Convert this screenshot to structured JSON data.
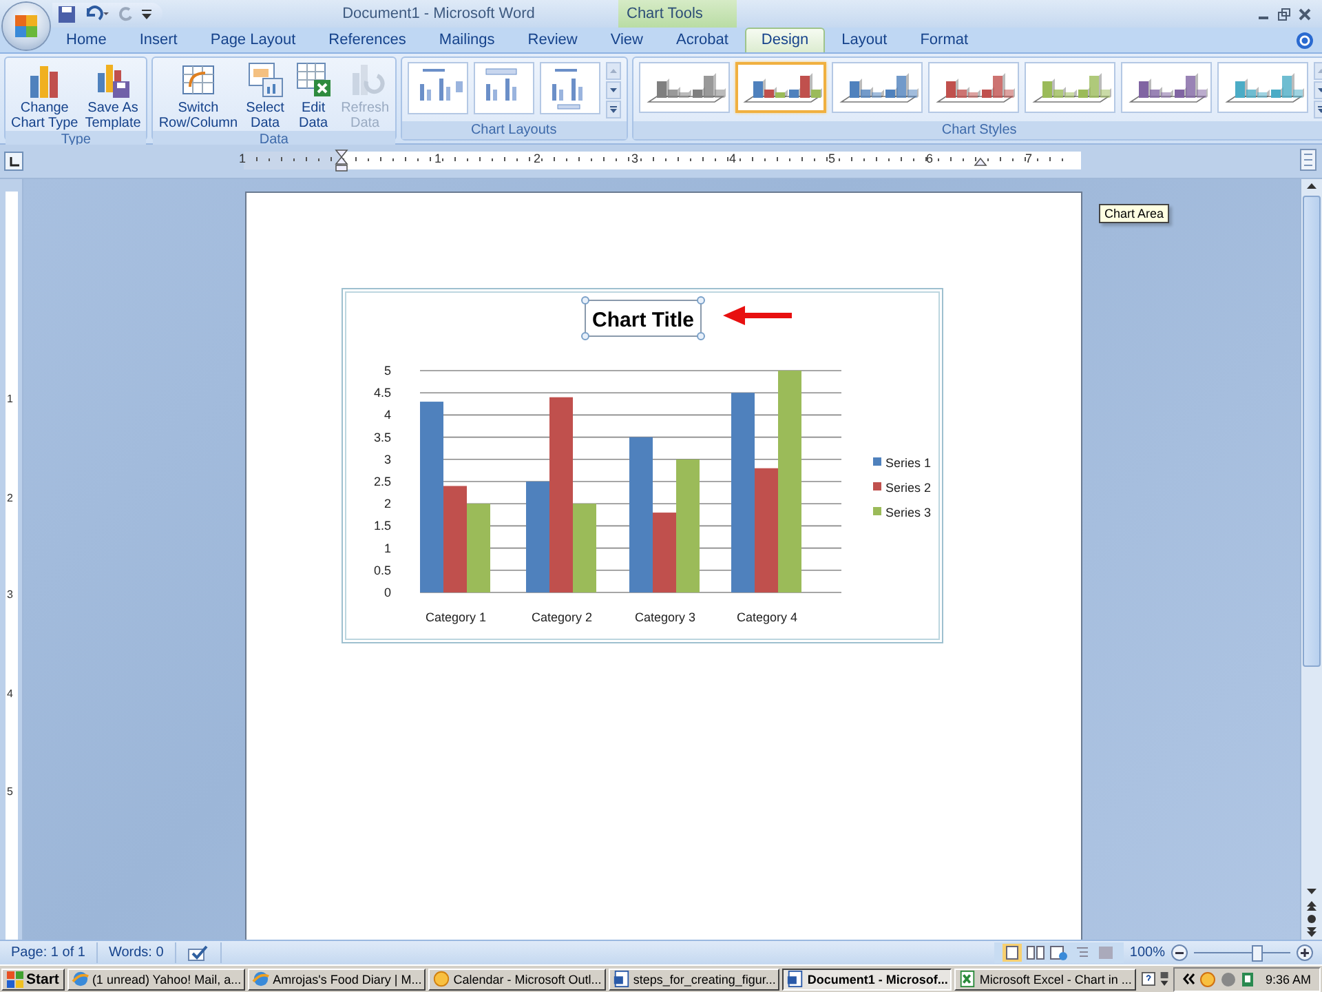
{
  "title_bar": {
    "title": "Document1 - Microsoft Word",
    "contextual_tab": "Chart Tools"
  },
  "tabs": [
    {
      "label": "Home",
      "selected": false
    },
    {
      "label": "Insert",
      "selected": false
    },
    {
      "label": "Page Layout",
      "selected": false
    },
    {
      "label": "References",
      "selected": false
    },
    {
      "label": "Mailings",
      "selected": false
    },
    {
      "label": "Review",
      "selected": false
    },
    {
      "label": "View",
      "selected": false
    },
    {
      "label": "Acrobat",
      "selected": false
    },
    {
      "label": "Design",
      "selected": true
    },
    {
      "label": "Layout",
      "selected": false
    },
    {
      "label": "Format",
      "selected": false
    }
  ],
  "ribbon_groups": [
    {
      "label": "Type",
      "buttons": [
        {
          "kind": "chart-type",
          "lines": [
            "Change",
            "Chart Type"
          ],
          "disabled": false
        },
        {
          "kind": "save-template",
          "lines": [
            "Save As",
            "Template"
          ],
          "disabled": false
        }
      ]
    },
    {
      "label": "Data",
      "buttons": [
        {
          "kind": "switch",
          "lines": [
            "Switch",
            "Row/Column"
          ],
          "disabled": false
        },
        {
          "kind": "select-data",
          "lines": [
            "Select",
            "Data"
          ],
          "disabled": false
        },
        {
          "kind": "edit-data",
          "lines": [
            "Edit",
            "Data"
          ],
          "disabled": false
        },
        {
          "kind": "refresh",
          "lines": [
            "Refresh",
            "Data"
          ],
          "disabled": true
        }
      ]
    }
  ],
  "chart_layouts": {
    "label": "Chart Layouts",
    "items": [
      {
        "kind": "legend-right"
      },
      {
        "kind": "title-top"
      },
      {
        "kind": "axis-titles"
      }
    ]
  },
  "chart_styles": {
    "label": "Chart Styles",
    "items": [
      {
        "kind": "mono",
        "color": "#7f7f7f",
        "selected": false
      },
      {
        "kind": "multi",
        "selected": true
      },
      {
        "kind": "mono",
        "color": "#4f81bd",
        "selected": false
      },
      {
        "kind": "mono",
        "color": "#c0504d",
        "selected": false
      },
      {
        "kind": "mono",
        "color": "#9bbb59",
        "selected": false
      },
      {
        "kind": "mono",
        "color": "#8064a2",
        "selected": false
      },
      {
        "kind": "mono",
        "color": "#4bacc6",
        "selected": false
      }
    ]
  },
  "ruler": {
    "numbers": [
      "1",
      "1",
      "2",
      "3",
      "4",
      "5",
      "6",
      "7"
    ]
  },
  "vertical_ruler": {
    "numbers": [
      "1",
      "2",
      "3",
      "4",
      "5"
    ]
  },
  "chart": {
    "chart_data": {
      "type": "bar",
      "title": "Chart Title",
      "categories": [
        "Category 1",
        "Category 2",
        "Category 3",
        "Category 4"
      ],
      "series": [
        {
          "name": "Series 1",
          "color": "#4f81bd",
          "values": [
            4.3,
            2.5,
            3.5,
            4.5
          ]
        },
        {
          "name": "Series 2",
          "color": "#c0504d",
          "values": [
            2.4,
            4.4,
            1.8,
            2.8
          ]
        },
        {
          "name": "Series 3",
          "color": "#9bbb59",
          "values": [
            2,
            2,
            3,
            5
          ]
        }
      ],
      "ylim": [
        0,
        5
      ],
      "legend": true,
      "grid": true,
      "yticks": [
        {
          "value": 0,
          "label": "0"
        },
        {
          "value": 0.5,
          "label": "0.5"
        },
        {
          "value": 1,
          "label": "1"
        },
        {
          "value": 1.5,
          "label": "1.5"
        },
        {
          "value": 2,
          "label": "2"
        },
        {
          "value": 2.5,
          "label": "2.5"
        },
        {
          "value": 3,
          "label": "3"
        },
        {
          "value": 3.5,
          "label": "3.5"
        },
        {
          "value": 4,
          "label": "4"
        },
        {
          "value": 4.5,
          "label": "4.5"
        },
        {
          "value": 5,
          "label": "5"
        }
      ]
    },
    "tooltip": "Chart Area"
  },
  "status_bar": {
    "page": "Page: 1 of 1",
    "words": "Words: 0",
    "zoom": "100%",
    "zoom_level": {
      "level": 0.65
    }
  },
  "taskbar": {
    "start": "Start",
    "items": [
      {
        "label": "(1 unread) Yahoo! Mail, a...",
        "kind": "browser",
        "selected": false
      },
      {
        "label": "Amrojas's Food Diary | M...",
        "kind": "browser",
        "selected": false
      },
      {
        "label": "Calendar - Microsoft Outl...",
        "kind": "calendar",
        "selected": false
      },
      {
        "label": "steps_for_creating_figur...",
        "kind": "word",
        "selected": false
      },
      {
        "label": "Document1 - Microsof...",
        "kind": "word",
        "selected": true
      },
      {
        "label": "Microsoft Excel - Chart in ...",
        "kind": "excel",
        "selected": false
      }
    ],
    "clock": "9:36 AM"
  }
}
